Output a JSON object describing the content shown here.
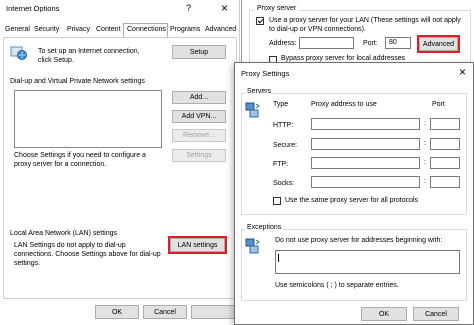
{
  "internet_options": {
    "title": "Internet Options",
    "help_glyph": "?",
    "close_glyph": "×",
    "tabs": [
      "General",
      "Security",
      "Privacy",
      "Content",
      "Connections",
      "Programs",
      "Advanced"
    ],
    "setup_text": "To set up an Internet connection, click Setup.",
    "setup_button": "Setup",
    "dialup_heading": "Dial-up and Virtual Private Network settings",
    "add_button": "Add...",
    "add_vpn_button": "Add VPN...",
    "remove_button": "Remove...",
    "settings_button": "Settings",
    "settings_hint": "Choose Settings if you need to configure a proxy server for a connection.",
    "lan_heading": "Local Area Network (LAN) settings",
    "lan_text": "LAN Settings do not apply to dial-up connections. Choose Settings above for dial-up settings.",
    "lan_button": "LAN settings",
    "ok_button": "OK",
    "cancel_button": "Cancel"
  },
  "lan_settings": {
    "proxy_group": "Proxy server",
    "use_proxy_label": "Use a proxy server for your LAN (These settings will not apply to dial-up or VPN connections).",
    "address_label": "Address:",
    "address_value": "",
    "port_label": "Port:",
    "port_value": "80",
    "advanced_button": "Advanced",
    "bypass_label": "Bypass proxy server for local addresses"
  },
  "proxy_settings": {
    "title": "Proxy Settings",
    "close_glyph": "×",
    "servers_group": "Servers",
    "col_type": "Type",
    "col_address": "Proxy address to use",
    "col_port": "Port",
    "rows": [
      {
        "label": "HTTP:",
        "address": "",
        "port": ""
      },
      {
        "label": "Secure:",
        "address": "",
        "port": ""
      },
      {
        "label": "FTP:",
        "address": "",
        "port": ""
      },
      {
        "label": "Socks:",
        "address": "",
        "port": ""
      }
    ],
    "colon": ":",
    "same_proxy_label": "Use the same proxy server for all protocols",
    "exceptions_group": "Exceptions",
    "exceptions_label": "Do not use proxy server for addresses beginning with:",
    "exceptions_value": "",
    "semicolons_hint": "Use semicolons ( ; ) to separate entries.",
    "ok_button": "OK",
    "cancel_button": "Cancel"
  },
  "colors": {
    "highlight_red": "#e01e2a",
    "button_face": "#e1e1e1",
    "dialog_bg": "#ffffff",
    "disabled_text": "#a0a0a0"
  }
}
